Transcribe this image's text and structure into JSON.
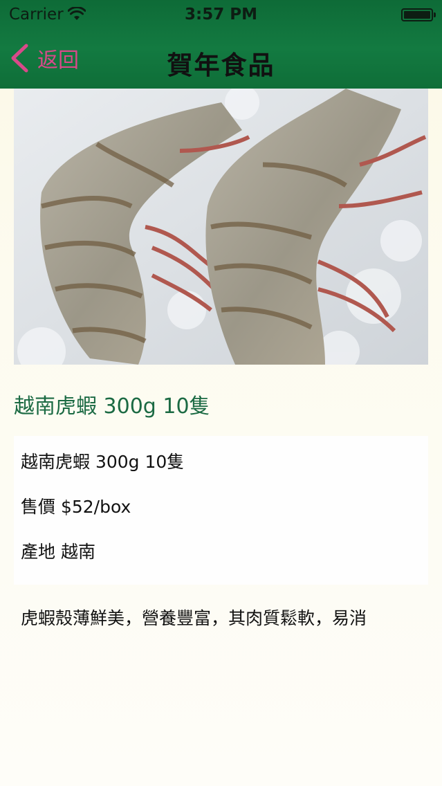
{
  "status_bar": {
    "carrier": "Carrier",
    "time": "3:57 PM"
  },
  "nav": {
    "back_label": "返回",
    "title": "賀年食品"
  },
  "product": {
    "image_icon": "shrimp-photo",
    "title": "越南虎蝦 300g 10隻",
    "details": {
      "name_line": "越南虎蝦 300g 10隻",
      "price_line": "售價 $52/box",
      "origin_line": "產地 越南"
    },
    "description": "虎蝦殼薄鮮美，營養豐富，其肉質鬆軟，易消"
  },
  "colors": {
    "header_green": "#137a41",
    "back_pink": "#d9498a",
    "title_green": "#1b6a43",
    "background": "#fdfbef"
  }
}
